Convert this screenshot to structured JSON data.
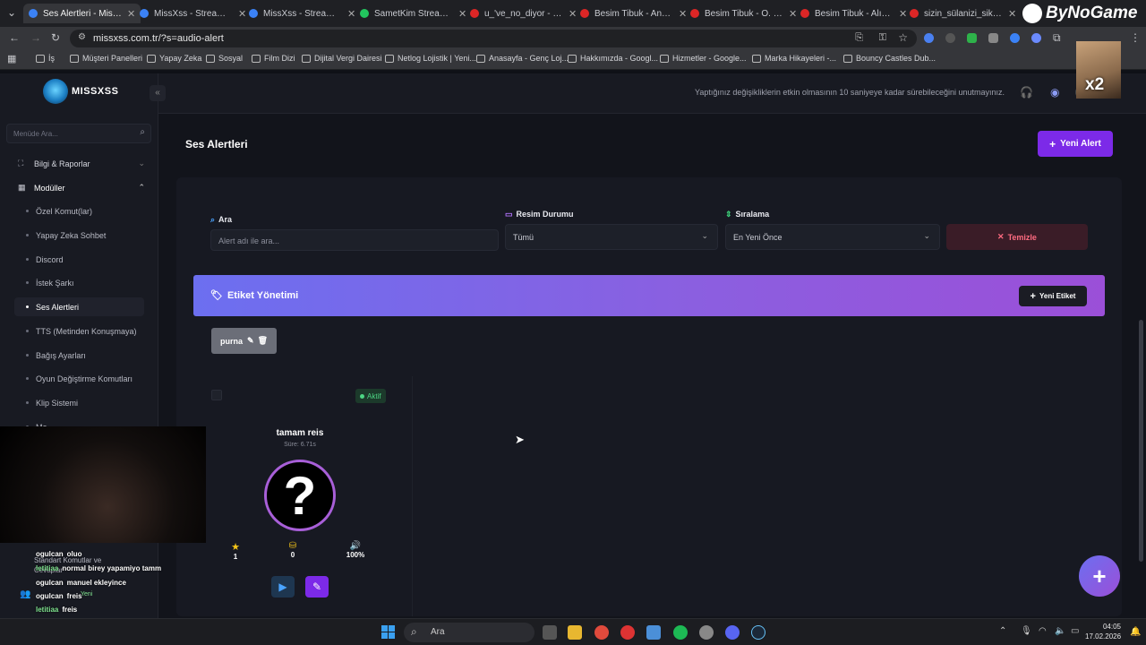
{
  "browser": {
    "tabs": [
      {
        "title": "Ses Alertleri - MissXss",
        "active": true,
        "color": "#3b82f6"
      },
      {
        "title": "MissXss - Streamer Pan",
        "active": false,
        "color": "#3b82f6"
      },
      {
        "title": "MissXss - Streamer Pan",
        "active": false,
        "color": "#3b82f6"
      },
      {
        "title": "SametKim Stream - W",
        "active": false,
        "color": "#22c55e"
      },
      {
        "title": "u_'ve_no_diyor - Insta",
        "active": false,
        "color": "#dc2626"
      },
      {
        "title": "Besim Tibuk - Ananın",
        "active": false,
        "color": "#dc2626"
      },
      {
        "title": "Besim Tibuk - O. Çoc",
        "active": false,
        "color": "#dc2626"
      },
      {
        "title": "Besim Tibuk - Alın Sil",
        "active": false,
        "color": "#dc2626"
      },
      {
        "title": "sizin_sülanizi_sikim_d",
        "active": false,
        "color": "#dc2626"
      }
    ],
    "url": "missxss.com.tr/?s=audio-alert",
    "bookmarks": [
      "İş",
      "Müşteri Panelleri",
      "Yapay Zeka",
      "Sosyal",
      "Film Dizi",
      "Dijital Vergi Dairesi",
      "Netlog Lojistik | Yeni...",
      "Anasayfa - Genç Loj...",
      "Hakkımızda - Googl...",
      "Hizmetler - Google...",
      "Marka Hikayeleri -...",
      "Bouncy Castles Dub..."
    ],
    "overlay_brand": "ByNoGame",
    "overlay_multiplier": "x2"
  },
  "app": {
    "logo_text": "MISSXSS",
    "top_notice": "Yaptığınız değişikliklerin etkin olmasının 10 saniyeye kadar sürebileceğini unutmayınız.",
    "sidebar": {
      "search_placeholder": "Menüde Ara...",
      "groups": [
        {
          "label": "Bilgi & Raporlar"
        },
        {
          "label": "Modüller"
        }
      ],
      "items": [
        "Özel Komut(lar)",
        "Yapay Zeka Sohbet",
        "Discord",
        "İstek Şarkı",
        "Ses Alertleri",
        "TTS (Metinden Konuşmaya)",
        "Bağış Ayarları",
        "Oyun Değiştirme Komutları",
        "Klip Sistemi",
        "Mo..."
      ],
      "bottom_text": "Standart Komutlar ve Cevaplar",
      "bottom_badge": "Yeni"
    },
    "page_title": "Ses Alertleri",
    "new_alert_label": "Yeni Alert",
    "filters": {
      "search_label": "Ara",
      "search_placeholder": "Alert adı ile ara...",
      "image_status_label": "Resim Durumu",
      "image_status_value": "Tümü",
      "sort_label": "Sıralama",
      "sort_value": "En Yeni Önce",
      "clear_label": "Temizle"
    },
    "tags": {
      "title": "Etiket Yönetimi",
      "new_tag_label": "Yeni Etiket",
      "items": [
        "purna"
      ]
    },
    "alert_card": {
      "status": "Aktif",
      "name": "tamam reis",
      "duration": "Süre: 6.71s",
      "stats": [
        {
          "icon": "star-icon",
          "value": "1"
        },
        {
          "icon": "coins-icon",
          "value": "0"
        },
        {
          "icon": "volume-icon",
          "value": "100%"
        }
      ]
    }
  },
  "chat": [
    {
      "user": "ogulcan",
      "msg": "oluo",
      "color": "#ffffff"
    },
    {
      "user": "letitiaa",
      "msg": "normal birey yapamiyo tamm",
      "color": "#7fe38f"
    },
    {
      "user": "ogulcan",
      "msg": "manuel ekleyince",
      "color": "#ffffff"
    },
    {
      "user": "ogulcan",
      "msg": "freis",
      "color": "#ffffff"
    },
    {
      "user": "letitiaa",
      "msg": "freis",
      "color": "#7fe38f"
    },
    {
      "user": "letitiaa",
      "msg": "",
      "color": "#7fe38f"
    },
    {
      "user": "ogulcan",
      "msg": "",
      "color": "#ffffff"
    }
  ],
  "taskbar": {
    "search_label": "Ara",
    "time": "04:05",
    "date": "17.02.2026"
  }
}
